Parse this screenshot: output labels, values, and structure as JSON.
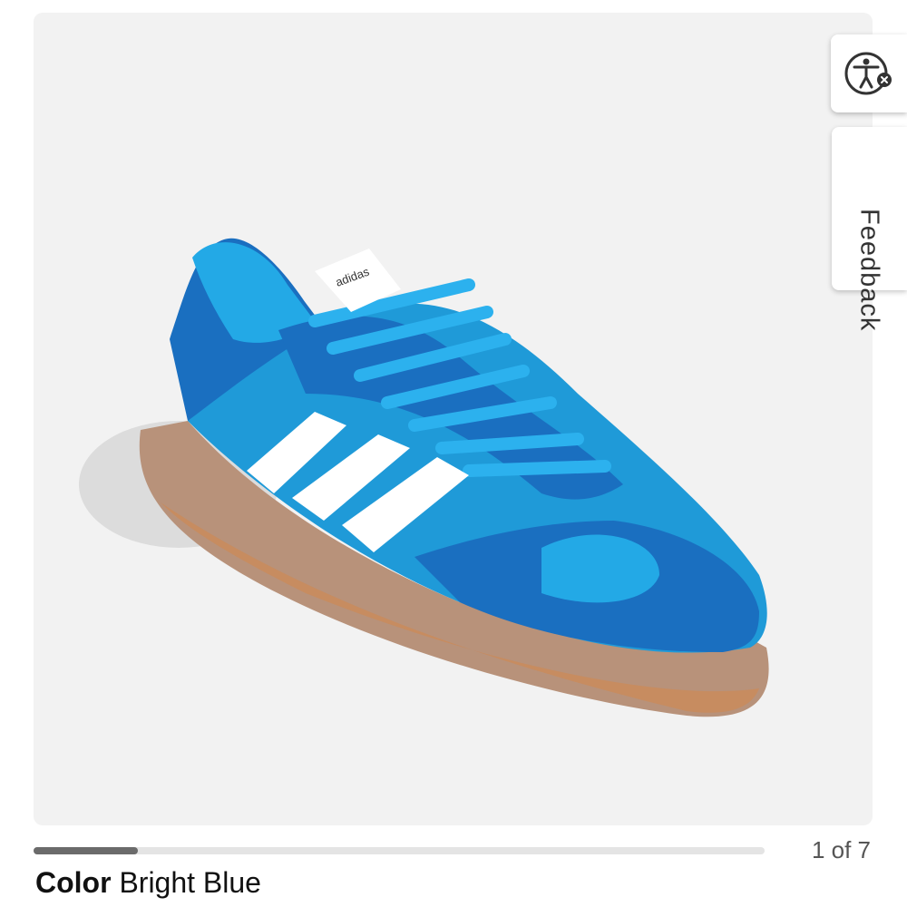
{
  "gallery": {
    "image_alt": "Bright Blue sneaker",
    "brand_tag": "adidas",
    "current_index": 1,
    "total_images": 7,
    "counter_text": "1 of 7",
    "progress_fraction": 0.143
  },
  "accessibility_button": {
    "icon": "accessibility-icon",
    "badge_icon": "close-icon"
  },
  "feedback_tab": {
    "label": "Feedback"
  },
  "color": {
    "label": "Color",
    "value": "Bright Blue"
  },
  "colors": {
    "background": "#f2f2f2",
    "shoe_primary": "#1f9ad8",
    "shoe_dark": "#1a6fc0",
    "stripes": "#ffffff",
    "sole": "#b8927a",
    "progress": "#6b6b6b"
  }
}
